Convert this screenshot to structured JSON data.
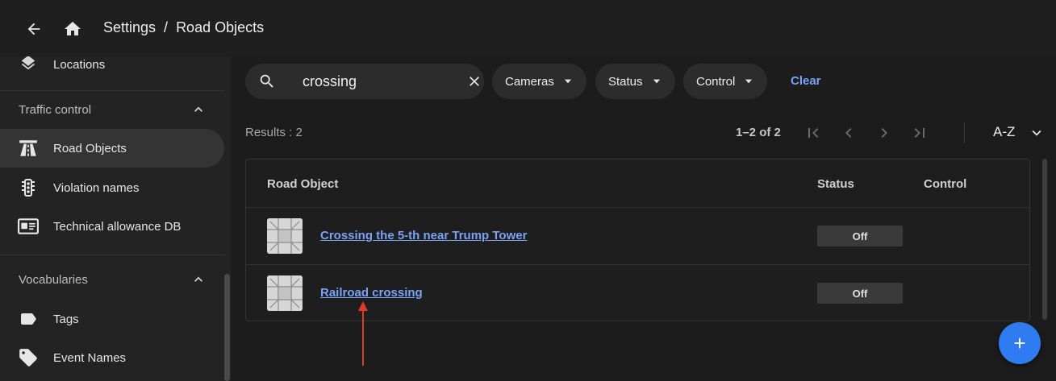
{
  "header": {
    "breadcrumb": [
      "Settings",
      "/",
      "Road Objects"
    ]
  },
  "sidebar": {
    "partial_item": "Locations",
    "sections": [
      {
        "title": "Traffic control",
        "items": [
          {
            "label": "Road Objects",
            "icon": "road-icon",
            "active": true
          },
          {
            "label": "Violation names",
            "icon": "traffic-light-icon"
          },
          {
            "label": "Technical allowance DB",
            "icon": "id-card-icon"
          }
        ]
      },
      {
        "title": "Vocabularies",
        "items": [
          {
            "label": "Tags",
            "icon": "tag-icon"
          },
          {
            "label": "Event Names",
            "icon": "tags-icon"
          }
        ]
      }
    ]
  },
  "search": {
    "value": "crossing"
  },
  "filters": [
    {
      "label": "Cameras"
    },
    {
      "label": "Status"
    },
    {
      "label": "Control"
    }
  ],
  "clear_label": "Clear",
  "results_label": "Results : 2",
  "pagination": {
    "range": "1–2 of 2"
  },
  "sort": {
    "label": "A-Z"
  },
  "table": {
    "columns": [
      "Road Object",
      "Status",
      "Control"
    ],
    "rows": [
      {
        "name": "Crossing the 5-th near Trump Tower",
        "status": "Off"
      },
      {
        "name": "Railroad crossing",
        "status": "Off"
      }
    ]
  },
  "colors": {
    "accent": "#2f7bf0",
    "link": "#7aa2f7",
    "background": "#1c1c1c",
    "annotation": "#e03a2f"
  }
}
